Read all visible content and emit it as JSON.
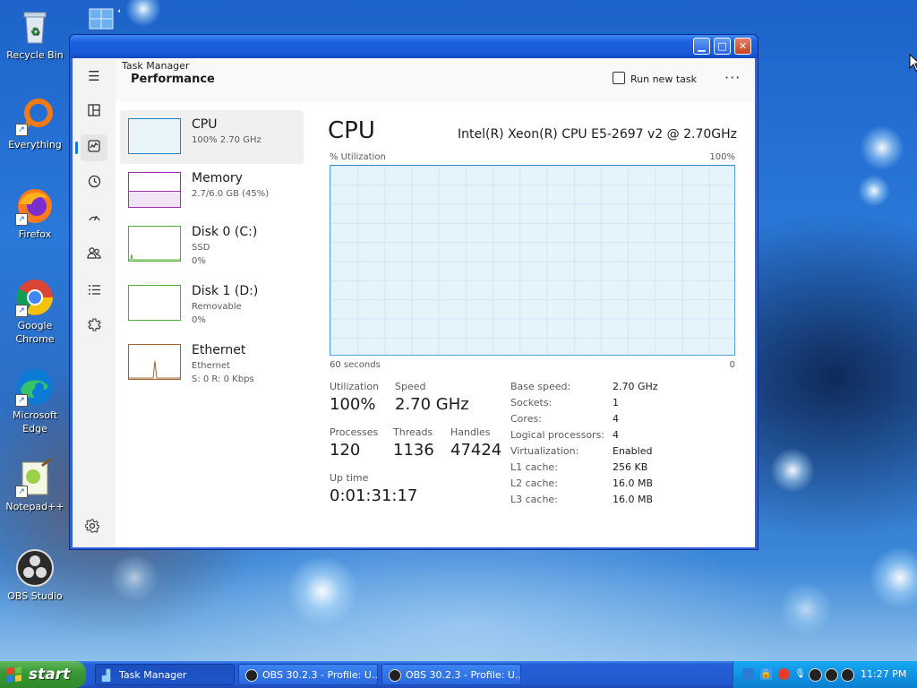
{
  "desktop": {
    "icons": [
      {
        "label": "Recycle Bin"
      },
      {
        "label": "Everything"
      },
      {
        "label": "Firefox"
      },
      {
        "label": "Google Chrome"
      },
      {
        "label": "Microsoft Edge"
      },
      {
        "label": "Notepad++"
      },
      {
        "label": "OBS Studio"
      }
    ]
  },
  "window": {
    "title": "Task Manager",
    "min_icon": "minimize-icon",
    "max_icon": "maximize-icon",
    "close_icon": "close-icon"
  },
  "nav": {
    "items": [
      {
        "icon": "hamburger-icon",
        "glyph": "☰"
      },
      {
        "icon": "processes-icon",
        "glyph": "▦"
      },
      {
        "icon": "performance-icon",
        "glyph": "📈",
        "selected": true
      },
      {
        "icon": "app-history-icon",
        "glyph": "↺"
      },
      {
        "icon": "startup-icon",
        "glyph": "⟳"
      },
      {
        "icon": "users-icon",
        "glyph": "👥"
      },
      {
        "icon": "details-icon",
        "glyph": "☷"
      },
      {
        "icon": "services-icon",
        "glyph": "⚙"
      }
    ],
    "settings_icon": "settings-icon"
  },
  "header": {
    "title": "Performance",
    "run_new_task": "Run new task",
    "more": "···"
  },
  "devices": [
    {
      "name": "CPU",
      "sub1": "100%  2.70 GHz",
      "sub2": "",
      "color": "#1a86c8",
      "selected": true
    },
    {
      "name": "Memory",
      "sub1": "2.7/6.0 GB (45%)",
      "sub2": "",
      "color": "#9b2fae"
    },
    {
      "name": "Disk 0 (C:)",
      "sub1": "SSD",
      "sub2": "0%",
      "color": "#4caf2f"
    },
    {
      "name": "Disk 1 (D:)",
      "sub1": "Removable",
      "sub2": "0%",
      "color": "#4caf2f"
    },
    {
      "name": "Ethernet",
      "sub1": "Ethernet",
      "sub2": "S: 0 R: 0 Kbps",
      "color": "#a0642a"
    }
  ],
  "detail": {
    "title": "CPU",
    "model": "Intel(R) Xeon(R) CPU E5-2697 v2 @ 2.70GHz",
    "graph_top_left": "% Utilization",
    "graph_top_right": "100%",
    "graph_bottom_left": "60 seconds",
    "graph_bottom_right": "0",
    "utilization_fraction": 1.0,
    "stats": {
      "utilization_label": "Utilization",
      "utilization_value": "100%",
      "speed_label": "Speed",
      "speed_value": "2.70 GHz",
      "processes_label": "Processes",
      "processes_value": "120",
      "threads_label": "Threads",
      "threads_value": "1136",
      "handles_label": "Handles",
      "handles_value": "47424",
      "uptime_label": "Up time",
      "uptime_value": "0:01:31:17"
    },
    "specs": [
      {
        "k": "Base speed:",
        "v": "2.70 GHz"
      },
      {
        "k": "Sockets:",
        "v": "1"
      },
      {
        "k": "Cores:",
        "v": "4"
      },
      {
        "k": "Logical processors:",
        "v": "4"
      },
      {
        "k": "Virtualization:",
        "v": "Enabled"
      },
      {
        "k": "L1 cache:",
        "v": "256 KB"
      },
      {
        "k": "L2 cache:",
        "v": "16.0 MB"
      },
      {
        "k": "L3 cache:",
        "v": "16.0 MB"
      }
    ]
  },
  "taskbar": {
    "start": "start",
    "buttons": [
      {
        "label": "Task Manager",
        "icon": "task-manager-icon"
      },
      {
        "label": "OBS 30.2.3 - Profile: U...",
        "icon": "obs-icon"
      },
      {
        "label": "OBS 30.2.3 - Profile: U...",
        "icon": "obs-icon"
      }
    ],
    "clock": "11:27 PM"
  }
}
